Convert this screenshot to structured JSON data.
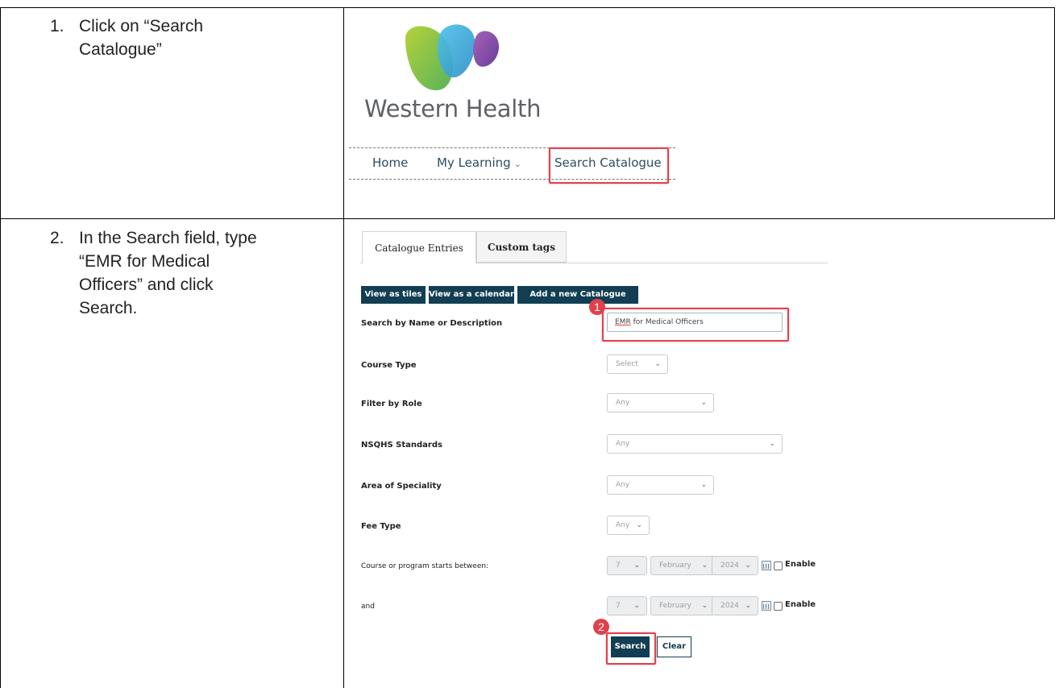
{
  "steps": [
    {
      "number": "1.",
      "line1": "Click on “Search",
      "line2": "Catalogue”"
    },
    {
      "number": "2.",
      "line1": "In the Search field, type",
      "line2": "“EMR for Medical",
      "line3": "Officers” and click",
      "line4": "Search."
    }
  ],
  "step1_screen": {
    "brand": "Western Health",
    "nav": {
      "home": "Home",
      "my_learning": "My Learning",
      "my_learning_chevron": "⌄",
      "search_catalogue": "Search Catalogue"
    }
  },
  "step2_screen": {
    "tabs": [
      "Catalogue Entries",
      "Custom tags"
    ],
    "buttons": [
      "View as tiles",
      "View as a calendar",
      "Add a new Catalogue Entry"
    ],
    "search_label": "Search by Name or Description",
    "search_value_emr": "EMR",
    "search_value_rest": " for Medical Officers",
    "filters": [
      {
        "label": "Course Type",
        "value": "Select"
      },
      {
        "label": "Filter by Role",
        "value": "Any"
      },
      {
        "label": "NSQHS Standards",
        "value": "Any"
      },
      {
        "label": "Area of Speciality",
        "value": "Any"
      },
      {
        "label": "Fee Type",
        "value": "Any"
      }
    ],
    "date_rows": [
      {
        "label": "Course or program starts between:",
        "day": "7",
        "month": "February",
        "year": "2024",
        "enable": "Enable"
      },
      {
        "label": "and",
        "day": "7",
        "month": "February",
        "year": "2024",
        "enable": "Enable"
      }
    ],
    "search_button": "Search",
    "clear_button": "Clear",
    "badges": [
      "1",
      "2"
    ],
    "caret": "⌄"
  },
  "colors": {
    "highlight": "#e0414b",
    "button_dark": "#123e53",
    "nav_text": "#2c4d5e"
  }
}
